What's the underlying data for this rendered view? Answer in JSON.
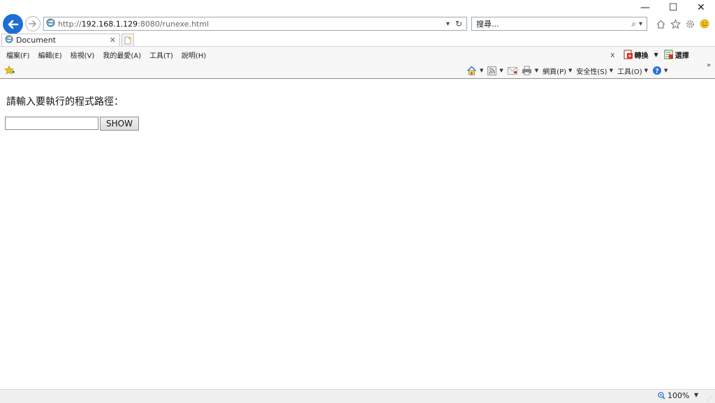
{
  "window": {
    "minimize_glyph": "—",
    "maximize_glyph": "☐",
    "close_glyph": "✕"
  },
  "address_bar": {
    "url_scheme": "http://",
    "url_host": "192.168.1.129",
    "url_rest": ":8080/runexe.html",
    "dropdown_glyph": "▾",
    "refresh_glyph": "↻"
  },
  "search_bar": {
    "placeholder": "搜尋...",
    "search_glyph": "⌕",
    "dropdown_glyph": "▾"
  },
  "tab": {
    "title": "Document",
    "close_glyph": "✕"
  },
  "menu": {
    "items": [
      "檔案(F)",
      "編輯(E)",
      "檢視(V)",
      "我的最愛(A)",
      "工具(T)",
      "說明(H)"
    ],
    "close_glyph": "x",
    "translate_label": "轉換",
    "select_label": "選擇"
  },
  "commandbar": {
    "page_label": "網頁(P)",
    "safety_label": "安全性(S)",
    "tools_label": "工具(O)",
    "more_glyph": "»"
  },
  "content": {
    "prompt": "請輸入要執行的程式路徑：",
    "input_value": "",
    "button_label": "SHOW"
  },
  "statusbar": {
    "zoom": "100%",
    "zoom_dropdown": "▼"
  },
  "colors": {
    "accent": "#1c6ed6",
    "chrome_bg": "#f7f7f7"
  },
  "icons": [
    "back-arrow-icon",
    "forward-arrow-icon",
    "ie-logo-icon",
    "home-icon",
    "star-icon",
    "gear-icon",
    "smiley-icon",
    "rss-icon",
    "mail-icon",
    "print-icon",
    "help-icon",
    "zoom-icon"
  ]
}
